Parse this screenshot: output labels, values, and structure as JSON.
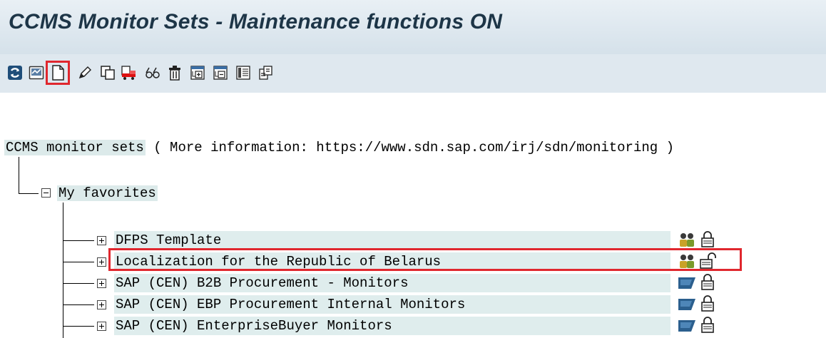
{
  "window": {
    "title": "CCMS Monitor Sets - Maintenance functions ON"
  },
  "toolbar": {
    "buttons": [
      {
        "icon": "refresh-icon",
        "label": "Refresh"
      },
      {
        "icon": "monitor-display-icon",
        "label": "Display"
      },
      {
        "icon": "create-new-icon",
        "label": "Create",
        "highlighted": true
      },
      {
        "icon": "pencil-icon",
        "label": "Change"
      },
      {
        "icon": "copy-icon",
        "label": "Copy"
      },
      {
        "icon": "transport-icon",
        "label": "Transport"
      },
      {
        "icon": "glasses-icon",
        "label": "Display"
      },
      {
        "icon": "trash-icon",
        "label": "Delete"
      },
      {
        "icon": "expand-subtree-icon",
        "label": "Expand subtree"
      },
      {
        "icon": "collapse-subtree-icon",
        "label": "Collapse subtree"
      },
      {
        "icon": "details-icon",
        "label": "Details"
      },
      {
        "icon": "settings-icon",
        "label": "Properties"
      }
    ]
  },
  "tree": {
    "root_label": "CCMS monitor sets",
    "root_info": "( More information: https://www.sdn.sap.com/irj/sdn/monitoring )",
    "folder": {
      "label": "My favorites",
      "expanded": true
    },
    "items": [
      {
        "label": "DFPS Template",
        "owner_icon": "users-icon",
        "lock_icon": "lock-closed-icon",
        "highlighted": false
      },
      {
        "label": "Localization for the Republic of Belarus",
        "owner_icon": "users-icon",
        "lock_icon": "lock-open-icon",
        "highlighted": true
      },
      {
        "label": "SAP (CEN) B2B Procurement - Monitors",
        "owner_icon": "sap-flag-icon",
        "lock_icon": "lock-closed-icon",
        "highlighted": false
      },
      {
        "label": "SAP (CEN) EBP Procurement Internal Monitors",
        "owner_icon": "sap-flag-icon",
        "lock_icon": "lock-closed-icon",
        "highlighted": false
      },
      {
        "label": "SAP (CEN) EnterpriseBuyer Monitors",
        "owner_icon": "sap-flag-icon",
        "lock_icon": "lock-closed-icon",
        "highlighted": false
      }
    ]
  },
  "colors": {
    "title_text": "#1d3547",
    "titlebar_bg": "#dce6ee",
    "highlight_red": "#e0272e",
    "row_bg": "#dfeded"
  }
}
